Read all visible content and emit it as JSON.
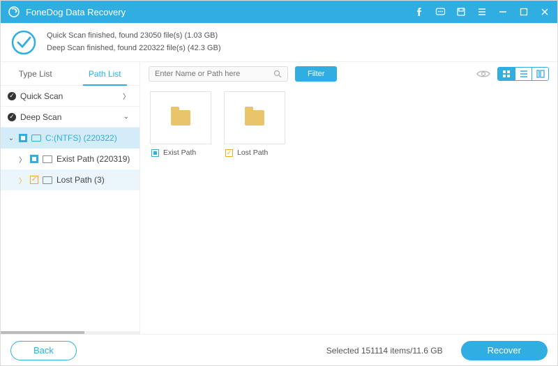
{
  "app": {
    "title": "FoneDog Data Recovery"
  },
  "status": {
    "line1": "Quick Scan finished, found 23050 file(s) (1.03 GB)",
    "line2": "Deep Scan finished, found 220322 file(s) (42.3 GB)"
  },
  "sidebar": {
    "tabs": {
      "type": "Type List",
      "path": "Path List"
    },
    "quick": "Quick Scan",
    "deep": "Deep Scan",
    "drive": "C:(NTFS) (220322)",
    "exist": "Exist Path (220319)",
    "lost": "Lost Path (3)"
  },
  "toolbar": {
    "search_placeholder": "Enter Name or Path here",
    "filter": "Filter"
  },
  "items": {
    "exist": "Exist Path",
    "lost": "Lost Path"
  },
  "footer": {
    "back": "Back",
    "selected": "Selected 151114 items/11.6 GB",
    "recover": "Recover"
  },
  "colors": {
    "accent": "#30aee1",
    "warn": "#f5a623"
  }
}
